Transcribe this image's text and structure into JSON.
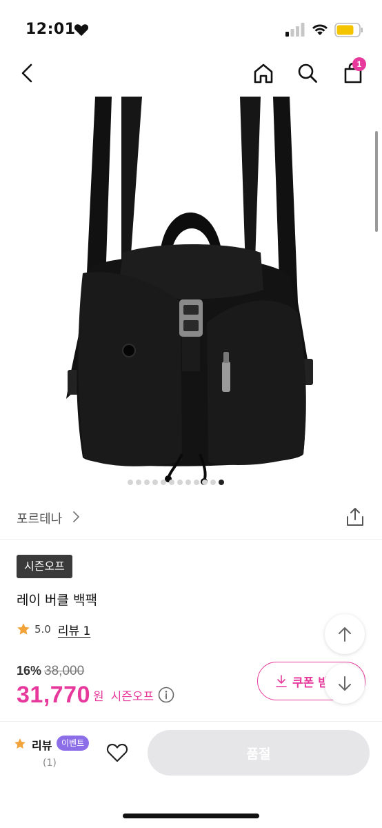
{
  "status_bar": {
    "time": "12:01"
  },
  "nav": {
    "cart_count": "1"
  },
  "gallery": {
    "dot_count": 12,
    "active_index": 11
  },
  "brand": {
    "name": "포르테나"
  },
  "product": {
    "badge": "시즌오프",
    "title": "레이 버클 백팩",
    "rating": "5.0",
    "review_link": "리뷰 1"
  },
  "price": {
    "discount": "16%",
    "original": "38,000",
    "sale": "31,770",
    "currency": "원",
    "note": "시즌오프"
  },
  "coupon": {
    "label": "쿠폰 받"
  },
  "bottom_bar": {
    "review_label": "리뷰",
    "event_badge": "이벤트",
    "review_count": "(1)",
    "buy_label": "품절"
  },
  "colors": {
    "accent": "#e7399b",
    "event": "#8c6fe8",
    "star": "#f2a33a",
    "disabled": "#e6e6e8"
  },
  "icons": [
    "heart-icon",
    "signal-icon",
    "wifi-icon",
    "battery-icon",
    "back-icon",
    "home-icon",
    "search-icon",
    "cart-icon",
    "chevron-right-icon",
    "share-icon",
    "star-icon",
    "info-icon",
    "download-icon",
    "arrow-up-icon",
    "arrow-down-icon",
    "heart-outline-icon"
  ]
}
